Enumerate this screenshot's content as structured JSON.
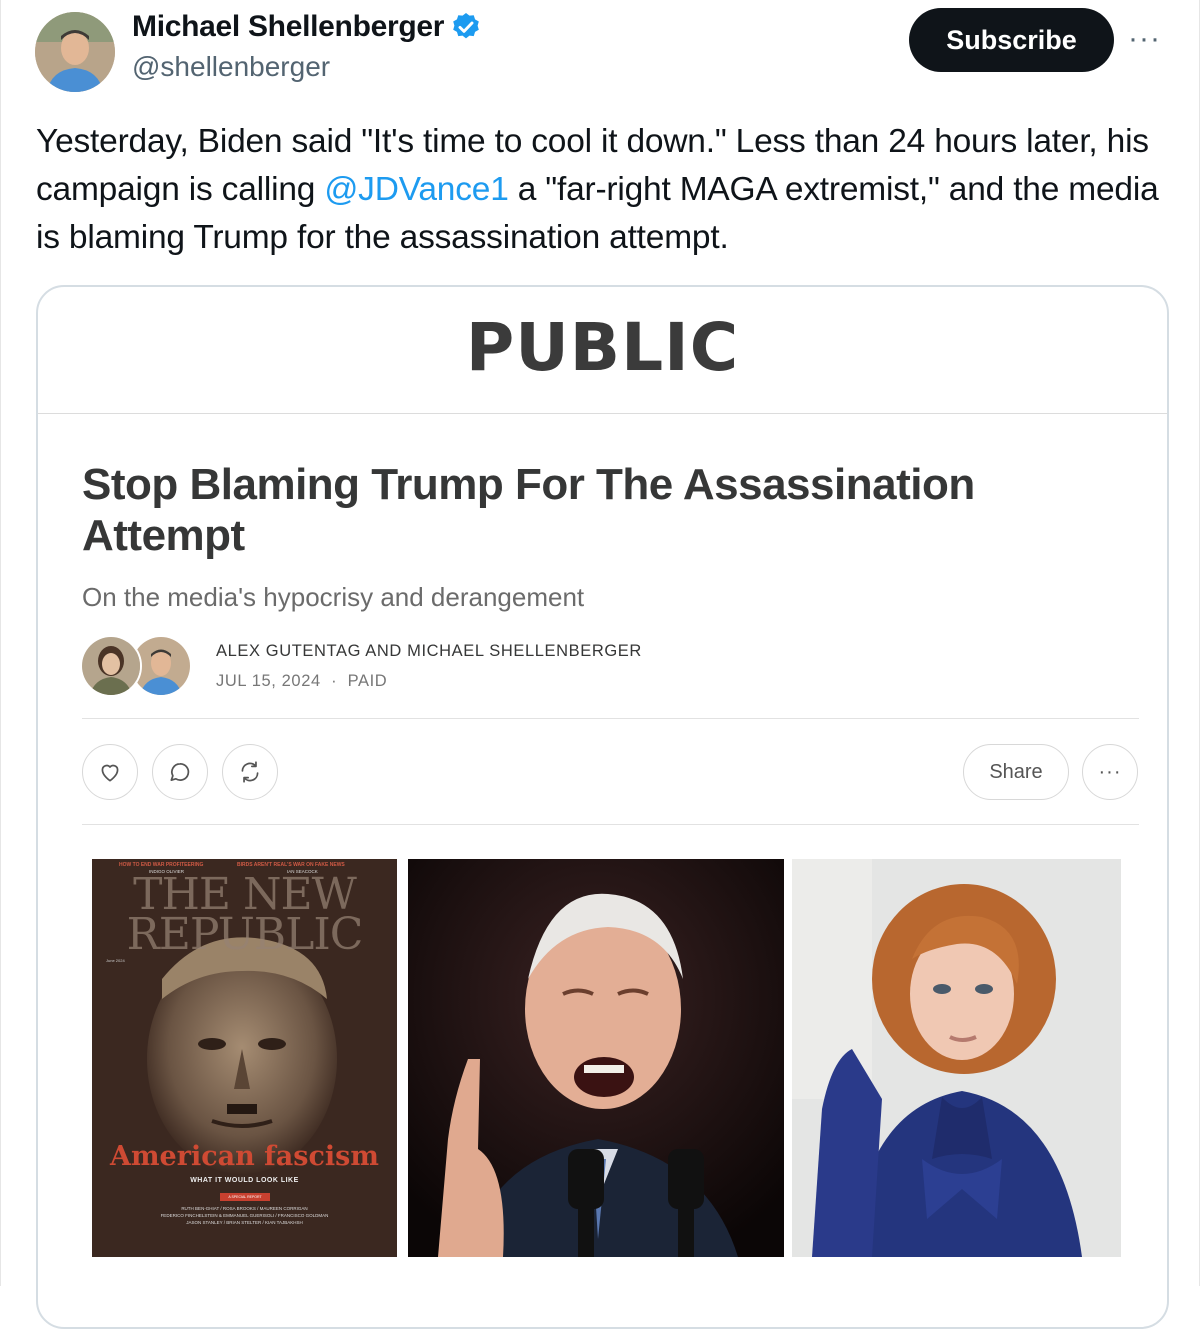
{
  "author": {
    "name": "Michael Shellenberger",
    "handle": "@shellenberger",
    "subscribe_label": "Subscribe",
    "more_label": "···"
  },
  "tweet": {
    "text_before": "Yesterday, Biden said \"It's time to cool it down.\" Less than 24 hours later, his campaign is calling ",
    "mention": "@JDVance1",
    "text_after": " a \"far-right MAGA extremist,\" and the media is blaming Trump for the assassination attempt."
  },
  "card": {
    "publication": "PUBLIC",
    "title": "Stop Blaming Trump For The Assassination Attempt",
    "subtitle": "On the media's hypocrisy and derangement",
    "authors": "ALEX GUTENTAG AND MICHAEL SHELLENBERGER",
    "date": "JUL 15, 2024",
    "separator": "·",
    "access": "PAID",
    "share_label": "Share",
    "more_label": "···"
  },
  "magazine": {
    "top_left": "HOW TO END WAR PROFITEERING",
    "top_left_author": "INDIGO OLIVIER",
    "top_right": "BIRDS AREN'T REAL'S WAR ON FAKE NEWS",
    "top_right_author": "IAN SEACOCK",
    "masthead_line1": "THE NEW",
    "masthead_line2": "REPUBLIC",
    "issue": "June 2024",
    "headline": "American fascism",
    "tagline": "WHAT IT WOULD LOOK LIKE",
    "report": "A SPECIAL REPORT",
    "contributors_1": "RUTH BEN-GHIAT / ROSA BROOKS / MAUREEN CORRIGAN",
    "contributors_2": "FEDERICO FINCHELSTEIN & EMMANUEL GUERISOLI / FRANCISCO GOLDMAN",
    "contributors_3": "JASON STANLEY / BRIAN STELTER / KIAN TAJBAKHSH"
  },
  "colors": {
    "accent_blue": "#1d9bf0",
    "subscribe_bg": "#0f1419",
    "magazine_red": "#c8402f"
  }
}
